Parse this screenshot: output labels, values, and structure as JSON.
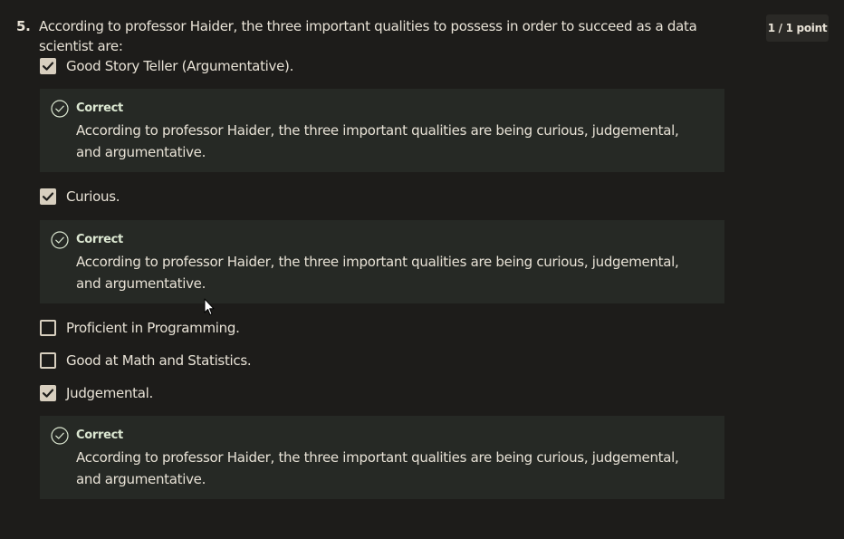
{
  "question": {
    "number": "5.",
    "text": "According to professor Haider, the three important qualities to possess in order to succeed as a data scientist are:",
    "points": "1 / 1 point"
  },
  "options": [
    {
      "label": "Good Story Teller (Argumentative).",
      "checked": true
    },
    {
      "label": "Curious.",
      "checked": true
    },
    {
      "label": "Proficient in Programming.",
      "checked": false
    },
    {
      "label": "Good at Math and Statistics.",
      "checked": false
    },
    {
      "label": "Judgemental.",
      "checked": true
    }
  ],
  "feedback": [
    {
      "title": "Correct",
      "text": "According to professor Haider, the three important qualities are being curious, judgemental, and argumentative."
    },
    {
      "title": "Correct",
      "text": "According to professor Haider, the three important qualities are being curious, judgemental, and argumentative."
    },
    {
      "title": "Correct",
      "text": "According to professor Haider, the three important qualities are being curious, judgemental, and argumentative."
    }
  ],
  "colors": {
    "background": "#1d1c1a",
    "checkbox": "#d8cfbf",
    "feedback_bg": "#262925",
    "correct_accent": "#dce8d2"
  },
  "icons": {
    "checked": "checkmark-icon",
    "correct": "check-circle-icon",
    "pointer": "mouse-cursor-icon"
  }
}
